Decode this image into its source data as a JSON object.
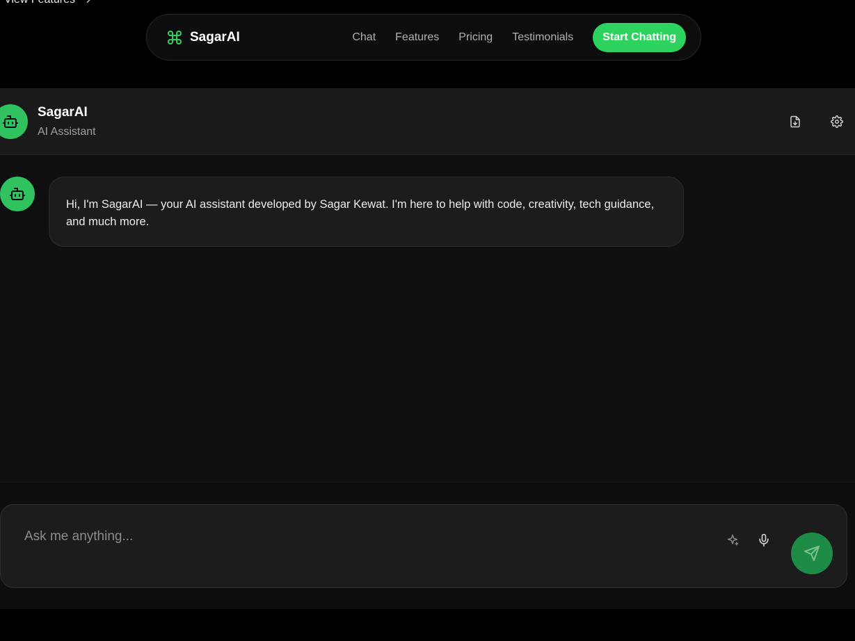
{
  "top_link": {
    "label": "View Features"
  },
  "navbar": {
    "brand": "SagarAI",
    "links": [
      "Chat",
      "Features",
      "Pricing",
      "Testimonials"
    ],
    "cta_label": "Start Chatting"
  },
  "chat_header": {
    "title": "SagarAI",
    "subtitle": "AI Assistant",
    "icons": [
      "export-icon",
      "gear-icon"
    ]
  },
  "messages": [
    {
      "sender": "assistant",
      "text": "Hi, I'm SagarAI — your AI assistant developed by Sagar Kewat. I'm here to help with code, creativity, tech guidance, and much more."
    }
  ],
  "input": {
    "placeholder": "Ask me anything...",
    "value": "",
    "icons": [
      "sparkle-icon",
      "microphone-icon",
      "send-icon"
    ]
  },
  "colors": {
    "accent": "#2ed35f",
    "avatar": "#2fc25f",
    "send": "#1e8c46",
    "background": "#000000",
    "panel": "#0f0f0f"
  }
}
